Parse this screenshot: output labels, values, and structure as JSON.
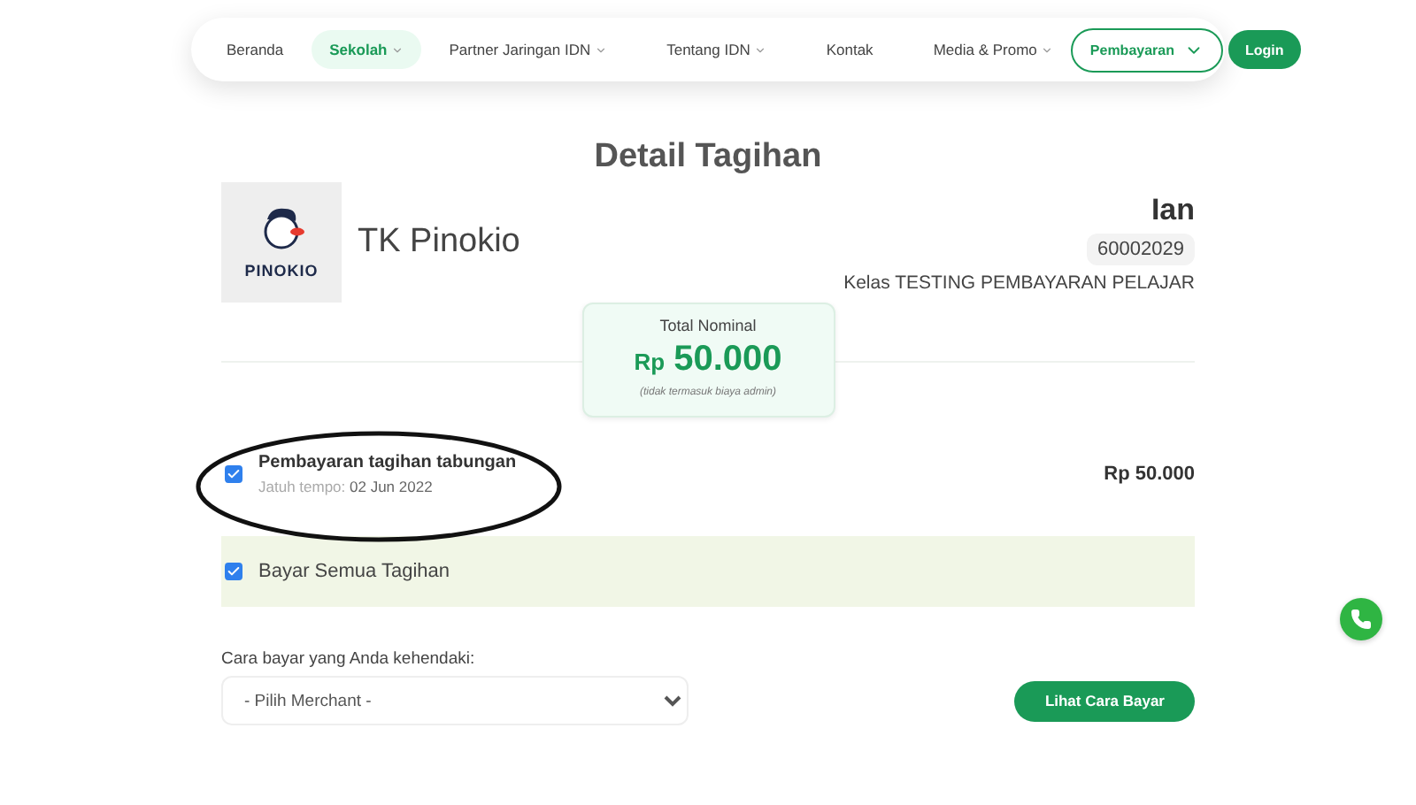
{
  "navbar": {
    "items": [
      {
        "label": "Beranda",
        "selected": false,
        "dropdown": false
      },
      {
        "label": "Sekolah",
        "selected": true,
        "dropdown": true
      },
      {
        "label": "Partner Jaringan IDN",
        "selected": false,
        "dropdown": true
      },
      {
        "label": "Tentang IDN",
        "selected": false,
        "dropdown": true
      },
      {
        "label": "Kontak",
        "selected": false,
        "dropdown": false
      },
      {
        "label": "Media & Promo",
        "selected": false,
        "dropdown": true
      }
    ],
    "payment_button": "Pembayaran",
    "login_button": "Login"
  },
  "title": "Detail Tagihan",
  "school": {
    "logo_text": "PINOKIO",
    "name": "TK Pinokio"
  },
  "student": {
    "name": "Ian",
    "id": "60002029",
    "class": "Kelas TESTING PEMBAYARAN PELAJAR"
  },
  "total": {
    "label": "Total Nominal",
    "currency": "Rp",
    "amount": "50.000",
    "note": "(tidak termasuk biaya admin)"
  },
  "bills": [
    {
      "title": "Pembayaran tagihan tabungan",
      "due_label": "Jatuh tempo:",
      "due_date": "02 Jun 2022",
      "amount": "Rp 50.000",
      "checked": true
    }
  ],
  "pay_all": {
    "label": "Bayar Semua Tagihan",
    "checked": true
  },
  "payment_method": {
    "label": "Cara bayar yang Anda kehendaki:",
    "placeholder": "- Pilih Merchant -",
    "button": "Lihat Cara Bayar"
  }
}
